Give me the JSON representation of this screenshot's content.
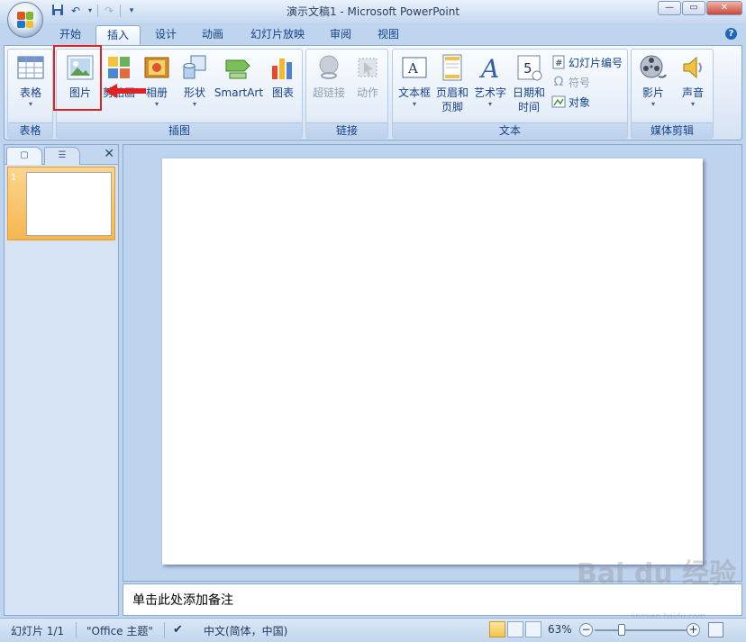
{
  "window": {
    "title": "演示文稿1 - Microsoft PowerPoint"
  },
  "tabs": [
    "开始",
    "插入",
    "设计",
    "动画",
    "幻灯片放映",
    "审阅",
    "视图"
  ],
  "active_tab": "插入",
  "ribbon": {
    "groups": {
      "table": "表格",
      "illustrations": "插图",
      "links": "链接",
      "text": "文本",
      "media": "媒体剪辑"
    },
    "buttons": {
      "table": "表格",
      "picture": "图片",
      "clipart": "剪贴画",
      "album": "相册",
      "shapes": "形状",
      "smartart": "SmartArt",
      "chart": "图表",
      "hyperlink": "超链接",
      "action": "动作",
      "textbox": "文本框",
      "header_footer_1": "页眉和",
      "header_footer_2": "页脚",
      "wordart": "艺术字",
      "datetime_1": "日期和",
      "datetime_2": "时间",
      "slide_number": "幻灯片编号",
      "symbol": "符号",
      "object": "对象",
      "movie": "影片",
      "sound": "声音"
    }
  },
  "slides_pane": {
    "slide_number": "1"
  },
  "notes_placeholder": "单击此处添加备注",
  "statusbar": {
    "slide_info": "幻灯片 1/1",
    "theme": "\"Office 主题\"",
    "language": "中文(简体，中国)",
    "zoom": "63%"
  },
  "watermark": {
    "text": "Bai du 经验",
    "sub": "jingyan.baidu.com"
  },
  "colors": {
    "highlight": "#e02222",
    "office_logo": [
      "#e2531f",
      "#7cbb2c",
      "#1a77c9",
      "#f6bf26"
    ]
  }
}
